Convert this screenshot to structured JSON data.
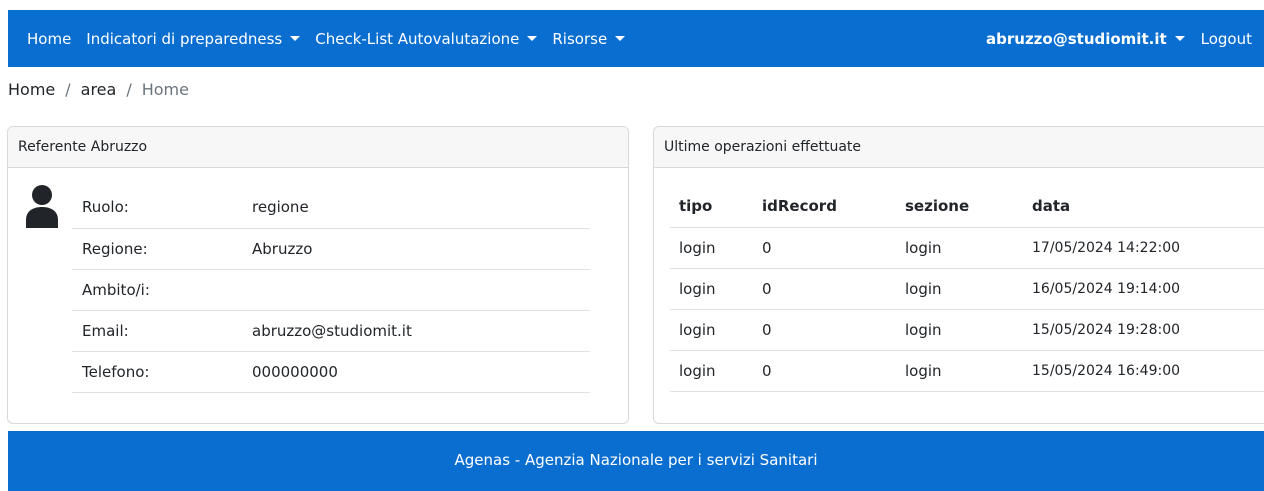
{
  "navbar": {
    "items": [
      {
        "label": "Home",
        "dropdown": false
      },
      {
        "label": "Indicatori di preparedness",
        "dropdown": true
      },
      {
        "label": "Check-List Autovalutazione",
        "dropdown": true
      },
      {
        "label": "Risorse",
        "dropdown": true
      }
    ],
    "user": "abruzzo@studiomit.it",
    "logout": "Logout"
  },
  "breadcrumb": [
    "Home",
    "area",
    "Home"
  ],
  "profile_card": {
    "title": "Referente Abruzzo",
    "rows": [
      {
        "label": "Ruolo:",
        "value": "regione"
      },
      {
        "label": "Regione:",
        "value": "Abruzzo"
      },
      {
        "label": "Ambito/i:",
        "value": ""
      },
      {
        "label": "Email:",
        "value": "abruzzo@studiomit.it"
      },
      {
        "label": "Telefono:",
        "value": "000000000"
      }
    ]
  },
  "operations_card": {
    "title": "Ultime operazioni effettuate",
    "columns": [
      "tipo",
      "idRecord",
      "sezione",
      "data"
    ],
    "rows": [
      [
        "login",
        "0",
        "login",
        "17/05/2024 14:22:00"
      ],
      [
        "login",
        "0",
        "login",
        "16/05/2024 19:14:00"
      ],
      [
        "login",
        "0",
        "login",
        "15/05/2024 19:28:00"
      ],
      [
        "login",
        "0",
        "login",
        "15/05/2024 16:49:00"
      ]
    ]
  },
  "footer": {
    "text": "Agenas - Agenzia Nazionale per i servizi Sanitari"
  },
  "colors": {
    "primary": "#0a6ed1"
  }
}
